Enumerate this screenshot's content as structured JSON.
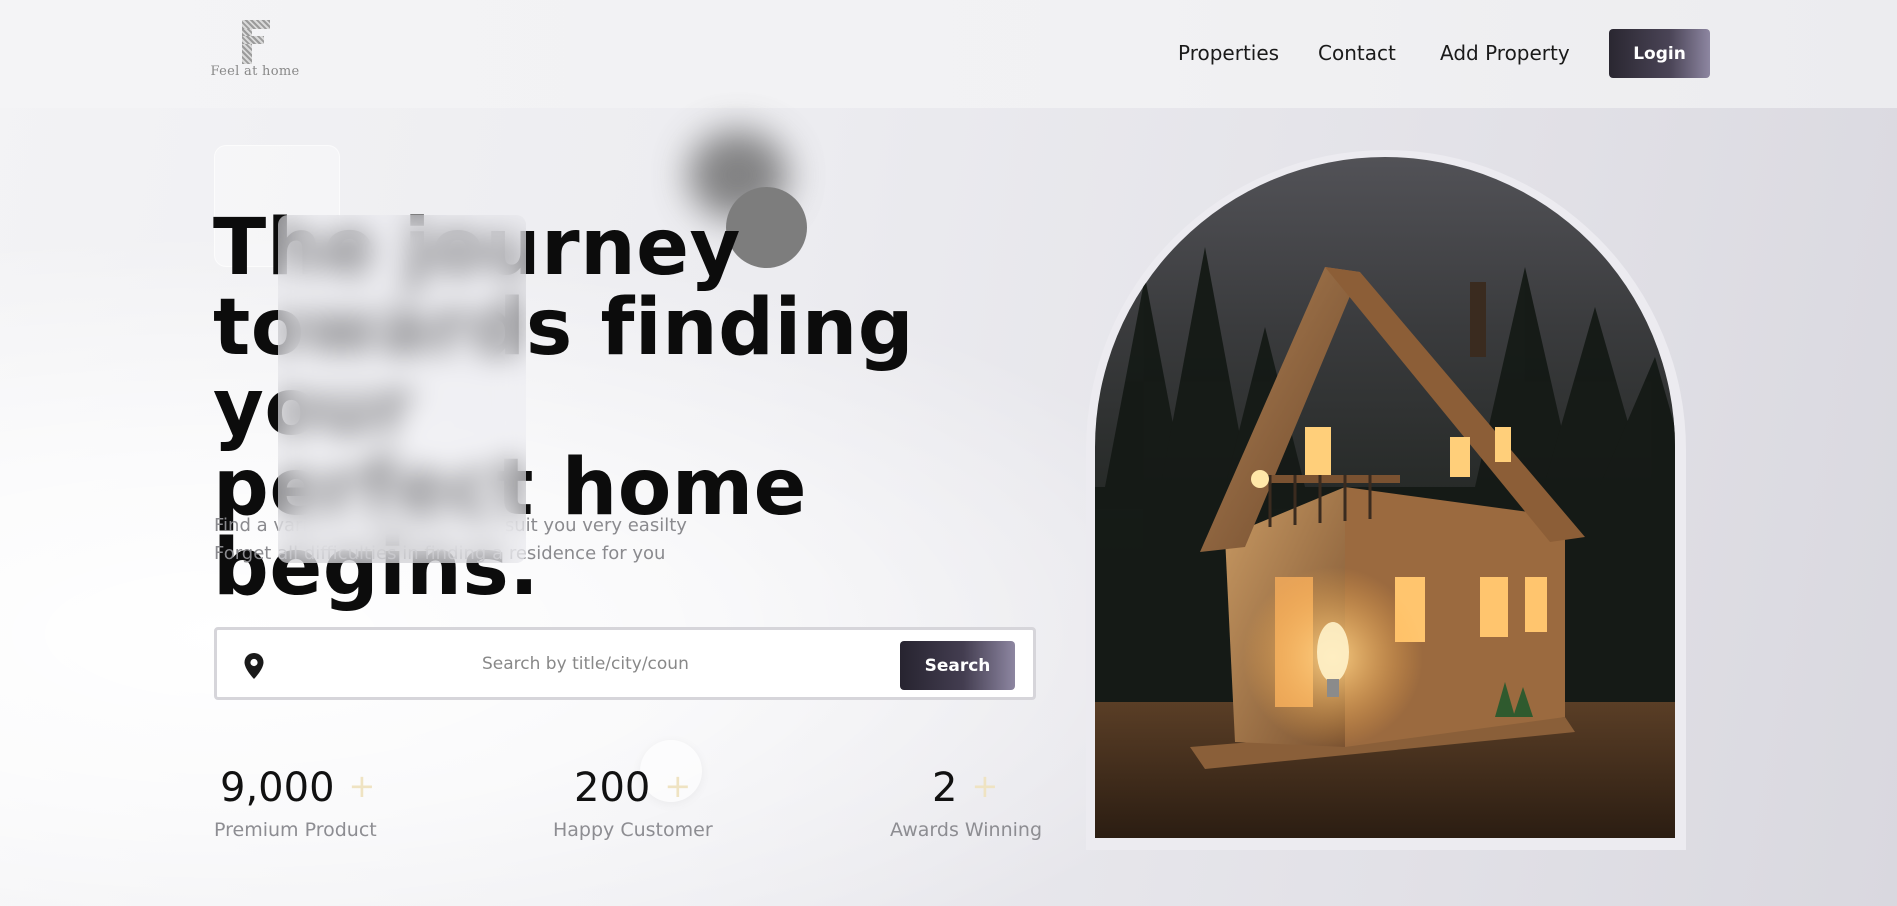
{
  "brand": {
    "logo_text": "Feel at home"
  },
  "nav": {
    "links": [
      "Properties",
      "Contact",
      "Add Property"
    ],
    "login_label": "Login"
  },
  "hero": {
    "title_lines": [
      "The journey",
      "towards finding your",
      "perfect home begins."
    ],
    "subtitle_lines": [
      "Find a variety of properties that suit you very easilty",
      "Forget all difficulties in finding a residence for you"
    ]
  },
  "search": {
    "placeholder": "Search by title/city/coun",
    "button_label": "Search",
    "icon": "location-pin-icon"
  },
  "stats": [
    {
      "value": "9,000",
      "suffix": "+",
      "label": "Premium Product"
    },
    {
      "value": "200",
      "suffix": "+",
      "label": "Happy Customer"
    },
    {
      "value": "2",
      "suffix": "+",
      "label": "Awards Winning"
    }
  ],
  "colors": {
    "button_dark": "#2a2731",
    "button_light": "#8d86a1",
    "plus_accent": "#efe3c2",
    "text_muted": "#8a8a8e"
  }
}
